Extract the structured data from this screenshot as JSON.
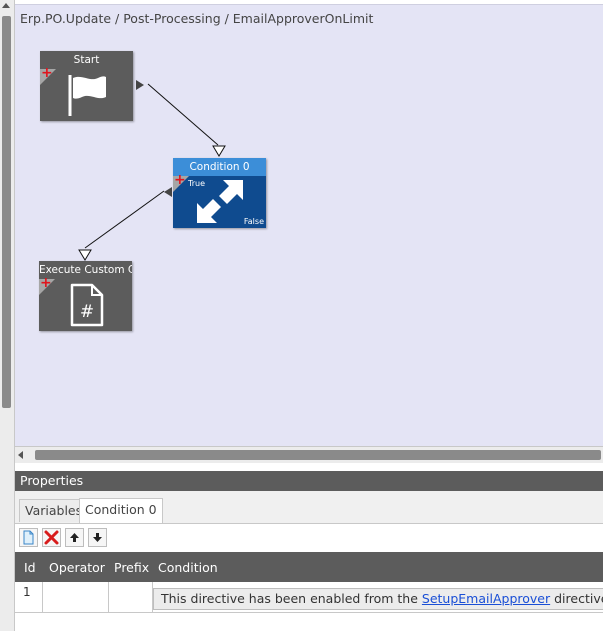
{
  "breadcrumb": "Erp.PO.Update / Post-Processing / EmailApproverOnLimit",
  "nodes": {
    "start": {
      "title": "Start",
      "icon": "flag-icon"
    },
    "condition": {
      "title": "Condition 0",
      "icon": "branch-arrows-icon",
      "true_label": "True",
      "false_label": "False"
    },
    "execute": {
      "title": "Execute Custom Co",
      "icon": "csharp-file-icon"
    }
  },
  "properties": {
    "title": "Properties",
    "tabs": [
      {
        "label": "Variables",
        "active": false
      },
      {
        "label": "Condition 0",
        "active": true
      }
    ],
    "toolbar": [
      "new-row-icon",
      "delete-icon",
      "move-up-icon",
      "move-down-icon"
    ],
    "grid": {
      "columns": [
        "Id",
        "Operator",
        "Prefix",
        "Condition"
      ],
      "rows": [
        {
          "id": "1",
          "operator": "",
          "prefix": "",
          "condition_prefix": "This directive has been enabled from the ",
          "condition_link": "SetupEmailApprover",
          "condition_suffix": " directive"
        }
      ]
    }
  },
  "colors": {
    "canvas": "#e4e4f5",
    "node_dark": "#5c5c5c",
    "condition_header": "#3c8ed8",
    "condition_body": "#0f4b8f",
    "add_red": "#e0141c",
    "link": "#1a4fd6"
  }
}
